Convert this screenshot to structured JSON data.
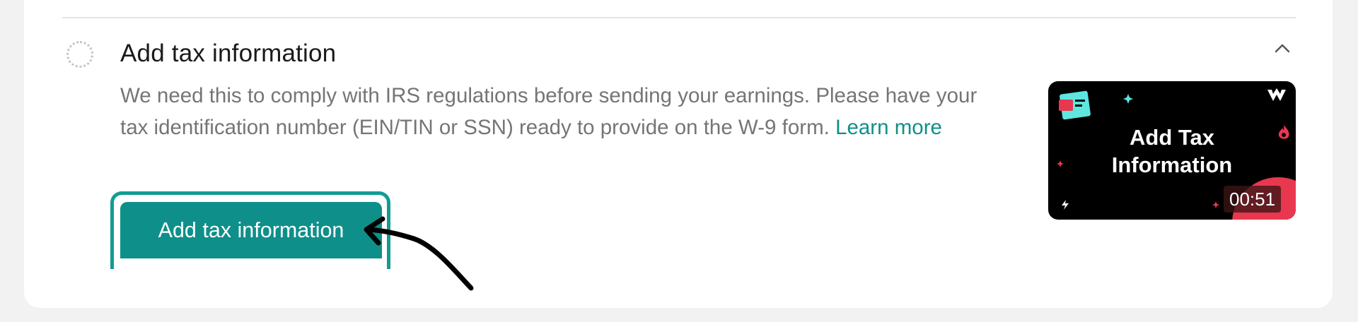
{
  "step": {
    "title": "Add tax information",
    "description": "We need this to comply with IRS regulations before sending your earnings. Please have your tax identification number (EIN/TIN or SSN) ready to provide on the W-9 form.",
    "learn_more": "Learn more",
    "button_label": "Add tax information",
    "status": "incomplete"
  },
  "video": {
    "title_line1": "Add Tax",
    "title_line2": "Information",
    "duration": "00:51"
  },
  "icons": {
    "status": "dotted-circle-icon",
    "collapse": "chevron-up-icon",
    "annotation": "hand-drawn-arrow-icon"
  },
  "colors": {
    "accent": "#0e8f8a",
    "video_accent_red": "#e8384f",
    "video_accent_teal": "#5ee6df"
  }
}
